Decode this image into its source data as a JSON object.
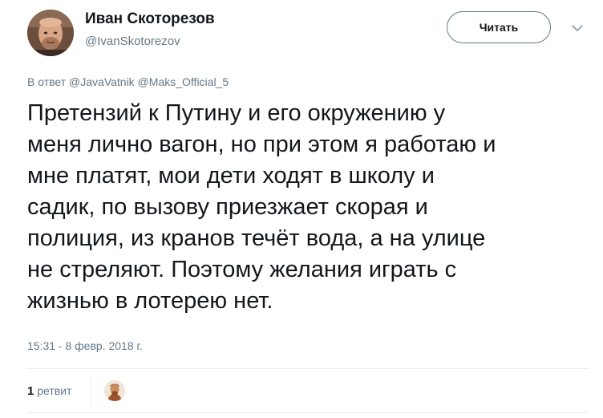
{
  "author": {
    "display_name": "Иван Скоторезов",
    "handle": "@IvanSkotorezov",
    "avatar_icon": "user-avatar-photo"
  },
  "header": {
    "follow_label": "Читать",
    "more_icon": "chevron-down-icon"
  },
  "reply": {
    "prefix": "В ответ",
    "mentions": [
      "@JavaVatnik",
      "@Maks_Official_5"
    ]
  },
  "tweet": {
    "lines": [
      "Претензий к Путину и его окружению у",
      "меня лично вагон, но при этом я работаю и",
      "мне платят, мои дети ходят в школу и",
      "садик, по вызову приезжает скорая и",
      "полиция, из кранов течёт вода, а на улице",
      "не стреляют. Поэтому желания играть с",
      "жизнью в лотерею нет."
    ]
  },
  "meta": {
    "timestamp": "15:31 - 8 февр. 2018 г."
  },
  "stats": {
    "retweet_count": "1",
    "retweet_label": "ретвит"
  },
  "colors": {
    "text_primary": "#14171a",
    "text_secondary": "#657786",
    "divider": "#e6ecf0",
    "background": "#ffffff"
  }
}
